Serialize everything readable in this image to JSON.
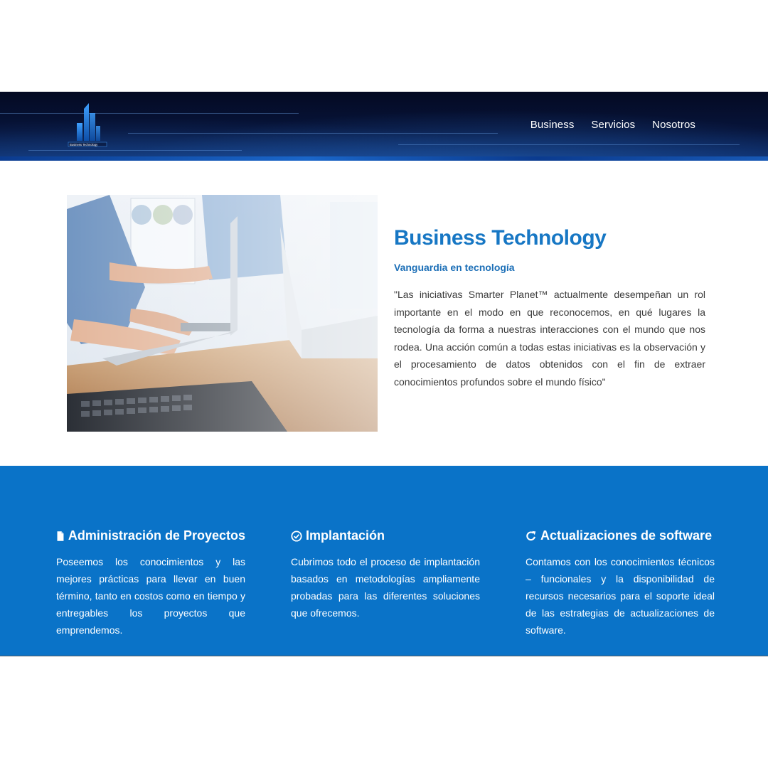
{
  "header": {
    "logo_text": "Business Technology",
    "nav": [
      "Business",
      "Servicios",
      "Nosotros"
    ]
  },
  "intro": {
    "title": "Business Technology",
    "subtitle": "Vanguardia en tecnología",
    "quote": "\"Las iniciativas Smarter Planet™ actualmente desempeñan un rol importante en el modo en que reconocemos, en qué lugares la tecnología da forma a nuestras interacciones con el mundo que nos rodea. Una acción común a todas estas iniciativas es la observación y el procesamiento de datos obtenidos con el fin de extraer conocimientos profundos sobre el mundo físico\""
  },
  "features": [
    {
      "icon": "file-icon",
      "title": "Administración de Proyectos",
      "text": "Poseemos los conocimientos y las mejores prácticas para llevar en buen término, tanto en costos como en tiempo y entregables los proyectos que emprendemos."
    },
    {
      "icon": "check-circle-icon",
      "title": "Implantación",
      "text": "Cubrimos todo el proceso de implantación basados en metodologías ampliamente probadas para las diferentes soluciones que ofrecemos."
    },
    {
      "icon": "refresh-icon",
      "title": "Actualizaciones de software",
      "text": "Contamos con los conocimientos técnicos – funcionales y la disponibilidad de recursos necesarios para el soporte ideal de las estrategias de actualizaciones de software."
    }
  ]
}
